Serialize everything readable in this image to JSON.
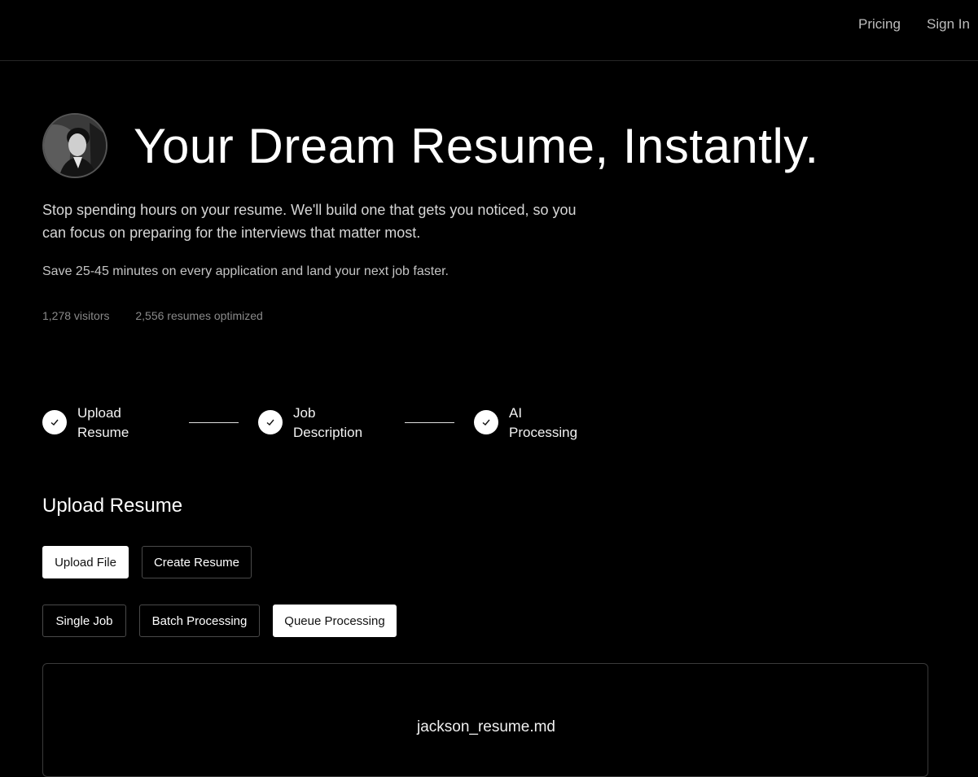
{
  "nav": {
    "pricing": "Pricing",
    "sign_in": "Sign In"
  },
  "hero": {
    "title": "Your Dream Resume, Instantly.",
    "subtitle": "Stop spending hours on your resume. We'll build one that gets you noticed, so you can focus on preparing for the interviews that matter most.",
    "save_text": "Save 25-45 minutes on every application and land your next job faster.",
    "stats": {
      "visitors": "1,278 visitors",
      "optimized": "2,556 resumes optimized"
    }
  },
  "steps": [
    {
      "line1": "Upload",
      "line2": "Resume",
      "icon": "check-icon"
    },
    {
      "line1": "Job",
      "line2": "Description",
      "icon": "check-icon"
    },
    {
      "line1": "AI",
      "line2": "Processing",
      "icon": "check-icon"
    }
  ],
  "upload": {
    "section_title": "Upload Resume",
    "mode_buttons": {
      "upload_file": "Upload File",
      "create_resume": "Create Resume"
    },
    "processing_buttons": {
      "single_job": "Single Job",
      "batch": "Batch Processing",
      "queue": "Queue Processing"
    },
    "file_name": "jackson_resume.md"
  },
  "colors": {
    "background": "#000000",
    "text": "#ffffff",
    "muted": "#8a8a8a",
    "border": "#4a4a4a"
  }
}
